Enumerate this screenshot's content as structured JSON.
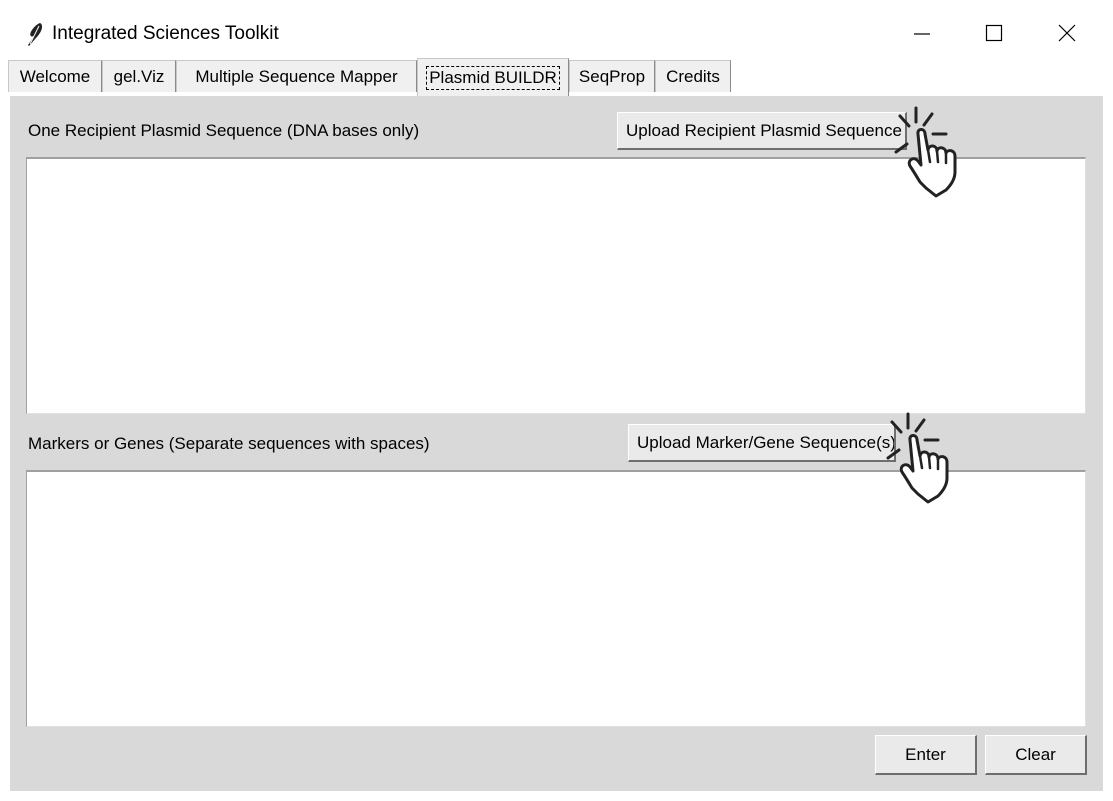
{
  "window": {
    "title": "Integrated Sciences Toolkit",
    "icons": {
      "app": "feather-icon",
      "minimize": "minimize-icon",
      "maximize": "maximize-icon",
      "close": "close-icon"
    }
  },
  "tabs": [
    {
      "label": "Welcome",
      "active": false
    },
    {
      "label": "gel.Viz",
      "active": false
    },
    {
      "label": "Multiple Sequence Mapper",
      "active": false
    },
    {
      "label": "Plasmid BUILDR",
      "active": true
    },
    {
      "label": "SeqProp",
      "active": false
    },
    {
      "label": "Credits",
      "active": false
    }
  ],
  "recipient": {
    "label": "One Recipient Plasmid Sequence (DNA bases only)",
    "upload_label": "Upload Recipient Plasmid Sequence",
    "value": ""
  },
  "markers": {
    "label": "Markers or Genes (Separate sequences with spaces)",
    "upload_label": "Upload Marker/Gene Sequence(s)",
    "value": ""
  },
  "actions": {
    "enter_label": "Enter",
    "clear_label": "Clear"
  },
  "annotations": {
    "pointer_icon": "click-hand-icon"
  },
  "colors": {
    "panel": "#d9d9d9",
    "tab": "#f0f0f0",
    "button": "#eaeaea",
    "field": "#ffffff"
  }
}
